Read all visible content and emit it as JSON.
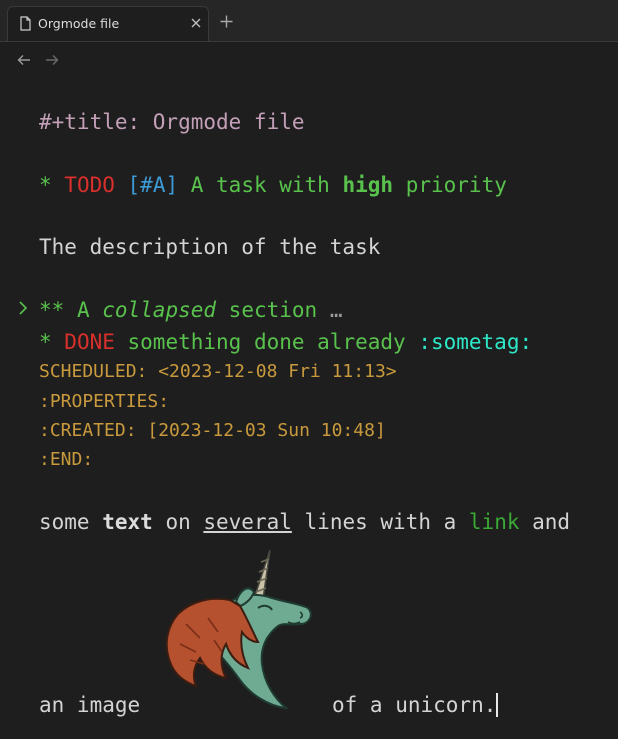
{
  "tab": {
    "title": "Orgmode file",
    "icon": "file-icon"
  },
  "icons": {
    "close": "close-icon",
    "new_tab": "plus-icon",
    "back": "arrow-left-icon",
    "forward": "arrow-right-icon",
    "fold": "chevron-right-icon"
  },
  "doc": {
    "title_line": "#+title: Orgmode file",
    "h1": {
      "star": "* ",
      "keyword": "TODO",
      "priority": "[#A]",
      "text_before": " A task with ",
      "bold": "high",
      "text_after": " priority"
    },
    "description": "The description of the task",
    "h2": {
      "stars": "** ",
      "text_before": "A ",
      "italic": "collapsed",
      "text_after": " section",
      "ellipsis": "…"
    },
    "h1b": {
      "star": "* ",
      "keyword": "DONE",
      "text": " something done already ",
      "tag": ":sometag:"
    },
    "scheduled": "SCHEDULED: <2023-12-08 Fri 11:13>",
    "properties": ":PROPERTIES:",
    "created": ":CREATED: [2023-12-03 Sun 10:48]",
    "end": ":END:",
    "para": {
      "w1": "some ",
      "bold": "text",
      "w2": " on ",
      "underline": "several",
      "w3": " lines with a ",
      "link": "link",
      "w4": " and"
    },
    "image_line": {
      "before": "an image",
      "after": "of a unicorn."
    }
  },
  "colors": {
    "background": "#1e1e1e",
    "heading": "#59c24d",
    "todo": "#d9302c",
    "priority": "#3c9ad6",
    "tag": "#2de8c8",
    "drawer": "#c99a3d",
    "meta": "#c3a0b8"
  }
}
